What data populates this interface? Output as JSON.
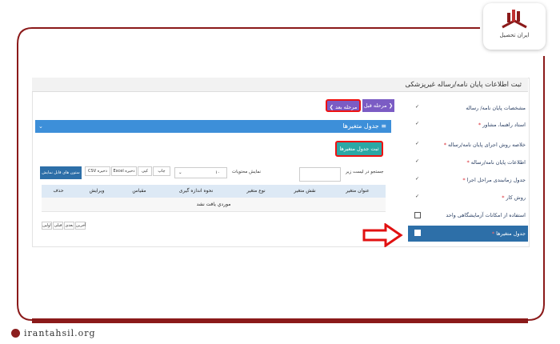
{
  "brand": {
    "logo_text": "ایران تحصیل",
    "website": "irantahsil.org"
  },
  "page": {
    "title": "ثبت اطلاعات پایان نامه/رساله غیرپزشکی"
  },
  "sidebar": {
    "items": [
      {
        "label": "مشخصات پایان نامه/ رساله",
        "required": false,
        "checked": true
      },
      {
        "label": "استاد راهنما، مشاور",
        "required": true,
        "checked": true
      },
      {
        "label": "خلاصه روش اجرای پایان نامه/رساله",
        "required": true,
        "checked": true
      },
      {
        "label": "اطلاعات پایان نامه/رساله",
        "required": true,
        "checked": true
      },
      {
        "label": "جدول زمانبندی مراحل اجرا",
        "required": true,
        "checked": true
      },
      {
        "label": "روش کار",
        "required": true,
        "checked": true
      },
      {
        "label": "استفاده از امکانات آزمایشگاهی واحد",
        "required": false,
        "checked": false
      },
      {
        "label": "جدول متغیرها",
        "required": true,
        "checked": false,
        "active": true
      }
    ],
    "star": "*",
    "check_mark": "✓"
  },
  "nav": {
    "prev_label": "❮ مرحله قبل",
    "next_label": "مرحله بعد ❯"
  },
  "panel": {
    "title": "≡ جدول متغیرها",
    "collapse_icon": "⌄",
    "add_button": "ثبت جدول متغیرها"
  },
  "toolbar": {
    "search_label": "جستجو در لیست زیر",
    "search_value": "",
    "show_label": "نمایش محتویات",
    "page_size": "۱۰",
    "buttons": [
      "چاپ",
      "کپی",
      "ذخیره Excel",
      "ذخیره CSV",
      "ستون های قابل نمایش"
    ]
  },
  "table": {
    "columns": [
      "عنوان متغیر",
      "نقش متغیر",
      "نوع متغیر",
      "نحوه اندازه گیری",
      "مقیاس",
      "ویرایش",
      "حذف"
    ],
    "empty_message": "موردي يافت نشد"
  },
  "pagination": {
    "buttons": [
      "اولین",
      "قبلی",
      "بعدی",
      "آخرین"
    ]
  },
  "colors": {
    "accent_blue": "#3d8fd9",
    "active_sidebar": "#2d6fa8",
    "nav_purple": "#7b5cc4",
    "add_teal": "#2ba8a6",
    "highlight_red": "#e11111",
    "brand_red": "#8b1a1a"
  }
}
